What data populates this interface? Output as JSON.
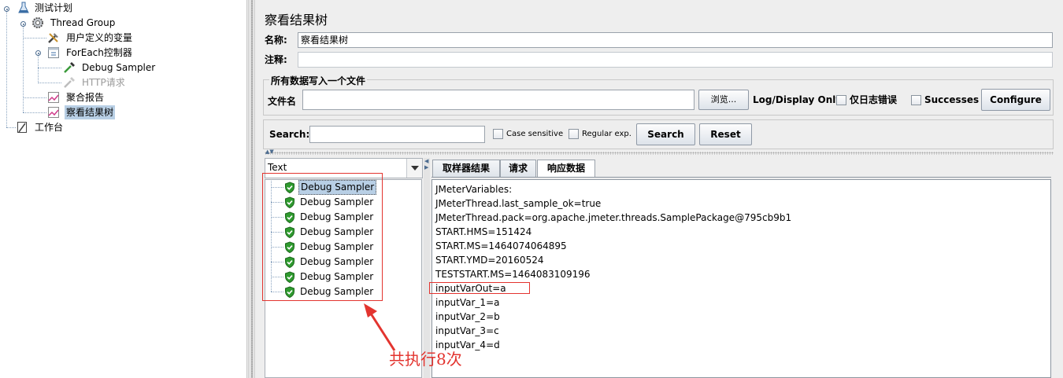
{
  "tree": {
    "nodes": [
      {
        "label": "测试计划",
        "icon": "flask-icon"
      },
      {
        "label": "Thread Group",
        "icon": "gear-icon"
      },
      {
        "label": "用户定义的变量",
        "icon": "wrench-icon"
      },
      {
        "label": "ForEach控制器",
        "icon": "controller-icon"
      },
      {
        "label": "Debug Sampler",
        "icon": "pipette-icon"
      },
      {
        "label": "HTTP请求",
        "icon": "pipette-icon",
        "disabled": true
      },
      {
        "label": "聚合报告",
        "icon": "graph-icon"
      },
      {
        "label": "察看结果树",
        "icon": "graph-icon",
        "selected": true
      },
      {
        "label": "工作台",
        "icon": "workbench-icon"
      }
    ]
  },
  "panel": {
    "title": "察看结果树",
    "name_label": "名称:",
    "name_value": "察看结果树",
    "comment_label": "注释:",
    "comment_value": "",
    "file_group_title": "所有数据写入一个文件",
    "filename_label": "文件名",
    "filename_value": "",
    "browse_label": "浏览...",
    "log_display_label": "Log/Display Only:",
    "errors_only_label": "仅日志错误",
    "successes_label": "Successes",
    "configure_label": "Configure"
  },
  "search": {
    "label": "Search:",
    "value": "",
    "case_sensitive_label": "Case sensitive",
    "regex_label": "Regular exp.",
    "search_button": "Search",
    "reset_button": "Reset"
  },
  "results": {
    "renderer": "Text",
    "samples": [
      "Debug Sampler",
      "Debug Sampler",
      "Debug Sampler",
      "Debug Sampler",
      "Debug Sampler",
      "Debug Sampler",
      "Debug Sampler",
      "Debug Sampler"
    ],
    "tabs": [
      "取样器结果",
      "请求",
      "响应数据"
    ],
    "active_tab": 2,
    "response_lines": [
      "JMeterVariables:",
      "JMeterThread.last_sample_ok=true",
      "JMeterThread.pack=org.apache.jmeter.threads.SamplePackage@795cb9b1",
      "START.HMS=151424",
      "START.MS=1464074064895",
      "START.YMD=20160524",
      "TESTSTART.MS=1464083109196",
      "inputVarOut=a",
      "inputVar_1=a",
      "inputVar_2=b",
      "inputVar_3=c",
      "inputVar_4=d"
    ]
  },
  "annotation": {
    "text": "共执行8次",
    "color": "#e3342f"
  }
}
